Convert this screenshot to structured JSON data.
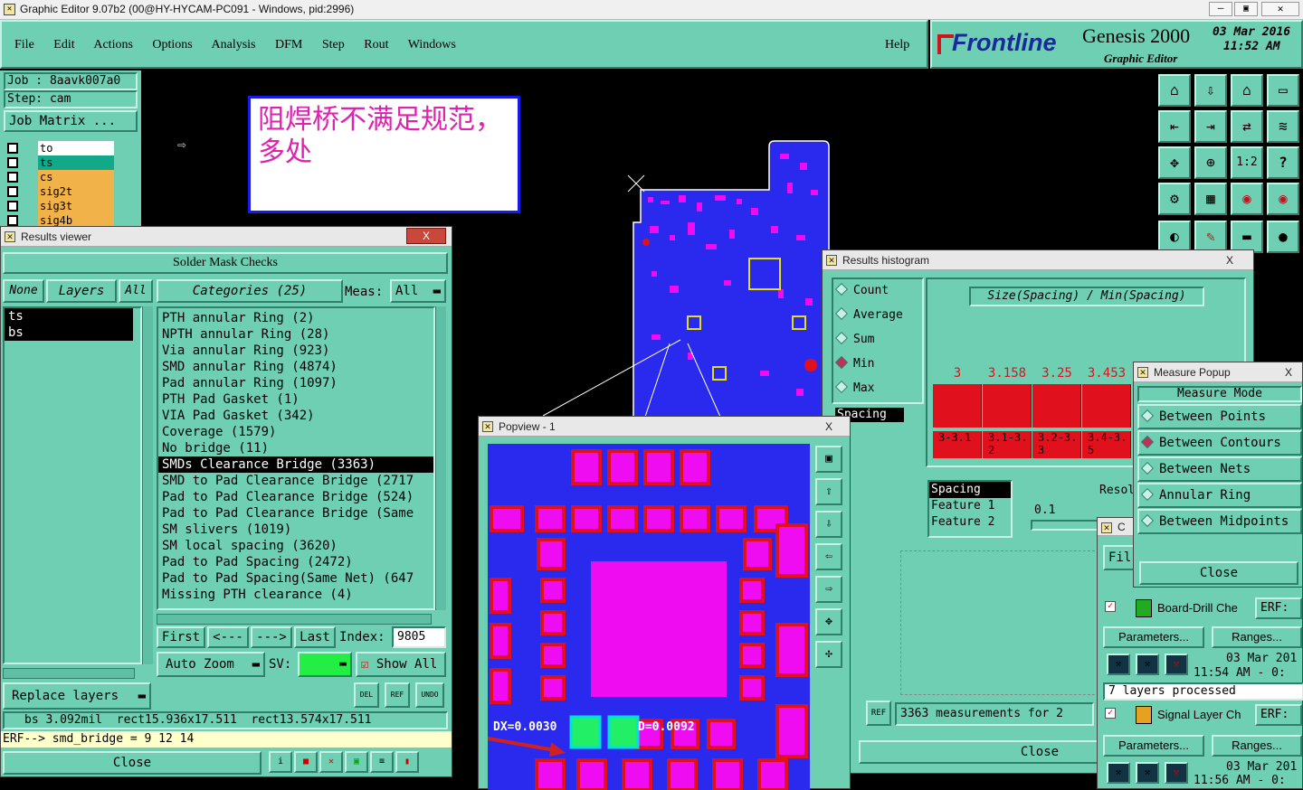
{
  "window": {
    "title": "Graphic Editor 9.07b2 (00@HY-HYCAM-PC091 - Windows, pid:2996)"
  },
  "menu": {
    "items": [
      "File",
      "Edit",
      "Actions",
      "Options",
      "Analysis",
      "DFM",
      "Step",
      "Rout",
      "Windows"
    ],
    "help": "Help"
  },
  "brand": {
    "logo": "Frontline",
    "product": "Genesis 2000",
    "subtitle": "Graphic Editor",
    "date": "03 Mar 2016",
    "time": "11:52 AM"
  },
  "job": {
    "job_label": "Job : 8aavk007a0",
    "step_label": "Step: cam",
    "matrix_button": "Job Matrix ..."
  },
  "layers": [
    {
      "name": "to",
      "color": "#ffffff"
    },
    {
      "name": "ts",
      "color": "#12a88a"
    },
    {
      "name": "cs",
      "color": "#f2b24a"
    },
    {
      "name": "sig2t",
      "color": "#f2b24a"
    },
    {
      "name": "sig3t",
      "color": "#f2b24a"
    },
    {
      "name": "sig4b",
      "color": "#f2b24a"
    }
  ],
  "annotation": {
    "text": "阻焊桥不满足规范，多处"
  },
  "results_viewer": {
    "title": "Results viewer",
    "close_x": "X",
    "header": "Solder Mask Checks",
    "none_btn": "None",
    "layers_btn": "Layers",
    "all_btn": "All",
    "layer_list": [
      "ts",
      "bs"
    ],
    "categories_label": "Categories (25)",
    "meas_label": "Meas:",
    "meas_value": "All",
    "categories": [
      "PTH annular Ring (2)",
      "NPTH annular Ring (28)",
      "Via annular Ring (923)",
      "SMD annular Ring (4874)",
      "Pad annular Ring (1097)",
      "PTH Pad Gasket (1)",
      "VIA Pad Gasket (342)",
      "Coverage (1579)",
      "No bridge (11)",
      "SMDs Clearance Bridge (3363)",
      "SMD to Pad Clearance Bridge (2717",
      "Pad to Pad Clearance Bridge (524)",
      "Pad to Pad Clearance Bridge (Same",
      "SM slivers (1019)",
      "SM local spacing (3620)",
      "Pad to Pad Spacing (2472)",
      "Pad to Pad Spacing(Same Net) (647",
      "Missing PTH clearance (4)"
    ],
    "selected_category_index": 9,
    "nav": {
      "first": "First",
      "prev": "<---",
      "next": "--->",
      "last": "Last",
      "index_label": "Index:",
      "index_value": "9805"
    },
    "auto_zoom": "Auto Zoom",
    "sv_label": "SV:",
    "show_all": "Show All",
    "replace_layers": "Replace layers",
    "status_line": "bs 3.092mil  rect15.936x17.511  rect13.574x17.511",
    "erf_line": "ERF--> smd_bridge = 9 12 14",
    "close": "Close",
    "small_btns": [
      "DEL",
      "REF",
      "UNDO"
    ]
  },
  "popview": {
    "title": "Popview - 1",
    "close_x": "X",
    "measure_text": "DX=0.0030",
    "measure_text2": "D=0.0092"
  },
  "histogram": {
    "title": "Results histogram",
    "close_x": "X",
    "options": [
      "Count",
      "Average",
      "Sum",
      "Min",
      "Max"
    ],
    "selected_option": "Min",
    "spacing_label": "Spacing",
    "chart_title": "Size(Spacing) / Min(Spacing)",
    "bars": [
      {
        "value": "3",
        "range": "3-3.1"
      },
      {
        "value": "3.158",
        "range": "3.1-3.2"
      },
      {
        "value": "3.25",
        "range": "3.2-3.3"
      },
      {
        "value": "3.453",
        "range": "3.4-3.5"
      }
    ],
    "feature_list": [
      "Spacing",
      "Feature 1",
      "Feature 2"
    ],
    "resol_label": "Resol",
    "resol_value": "0.1",
    "summary": "3363 measurements for 2",
    "close": "Close",
    "ref_btn": "REF"
  },
  "measure_popup": {
    "title": "Measure Popup",
    "close_x": "X",
    "mode_header": "Measure Mode",
    "modes": [
      "Between Points",
      "Between Contours",
      "Between Nets",
      "Annular Ring",
      "Between Midpoints"
    ],
    "selected_mode": "Between Contours",
    "close": "Close"
  },
  "checklist": {
    "file_label": "Fil",
    "item1": {
      "name": "Board-Drill Che",
      "erf": "ERF:",
      "params": "Parameters...",
      "ranges": "Ranges...",
      "date": "03 Mar 201",
      "time": "11:54 AM - 0:",
      "status": "7 layers processed"
    },
    "item2": {
      "name": "Signal Layer Ch",
      "erf": "ERF:",
      "params": "Parameters...",
      "ranges": "Ranges...",
      "date": "03 Mar 201",
      "time": "11:56 AM - 0:"
    }
  },
  "toolbar_icons": [
    "home-icon",
    "down-arrow-icon",
    "house-icon",
    "window-icon",
    "left-in-icon",
    "right-out-icon",
    "swap-icon",
    "s-curve-icon",
    "fit-icon",
    "zoom-icon",
    "ratio-icon",
    "help-icon",
    "tool-icon",
    "grid-icon",
    "drc-icon",
    "net-icon"
  ],
  "toolbar_labels": {
    "ratio": "1:2",
    "help": "?"
  },
  "pointer": {
    "glyph": "⇨"
  },
  "colors": {
    "panel": "#6fcfb3",
    "accent_red": "#e0101c",
    "pcb_blue": "#2a2aee",
    "pad_magenta": "#f00cf0",
    "highlight_green": "#22ee66"
  }
}
